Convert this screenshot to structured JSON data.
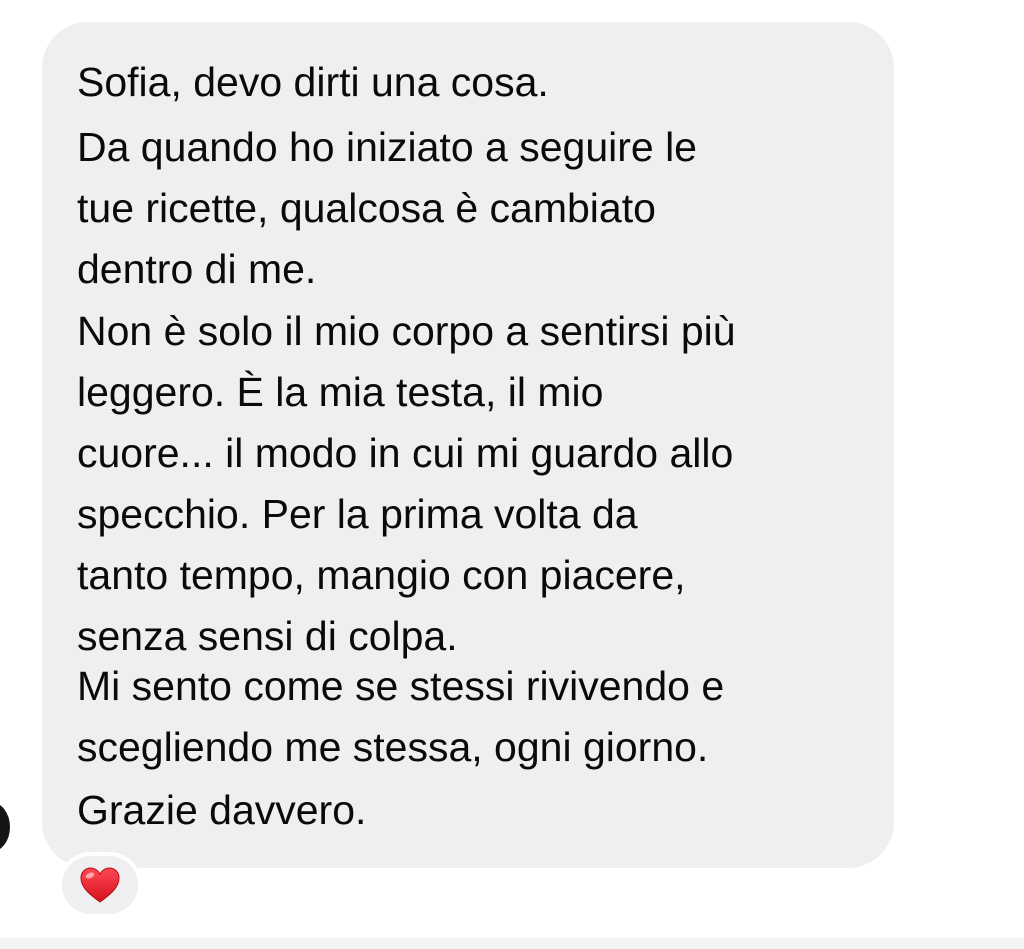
{
  "message": {
    "paragraphs": [
      {
        "lines": [
          "Sofia, devo dirti una cosa."
        ]
      },
      {
        "lines": [
          "Da quando ho iniziato a seguire le",
          "tue ricette, qualcosa è cambiato",
          "dentro di me."
        ]
      },
      {
        "lines": [
          "Non è solo il mio corpo a sentirsi più",
          "leggero. È la mia testa, il mio",
          "cuore... il modo in cui mi guardo allo",
          "specchio. Per la prima volta da",
          "tanto tempo, mangio con piacere,",
          "senza sensi di colpa."
        ]
      },
      {
        "lines": [
          "Mi sento come se stessi rivivendo e",
          "scegliendo me stessa, ogni giorno."
        ]
      },
      {
        "lines": [
          "Grazie davvero."
        ]
      }
    ]
  },
  "reaction": {
    "icon": "red-heart-icon",
    "color": "#e8202b"
  },
  "colors": {
    "bubble": "#efeff1",
    "text": "#0a0a0a",
    "background": "#ffffff"
  }
}
